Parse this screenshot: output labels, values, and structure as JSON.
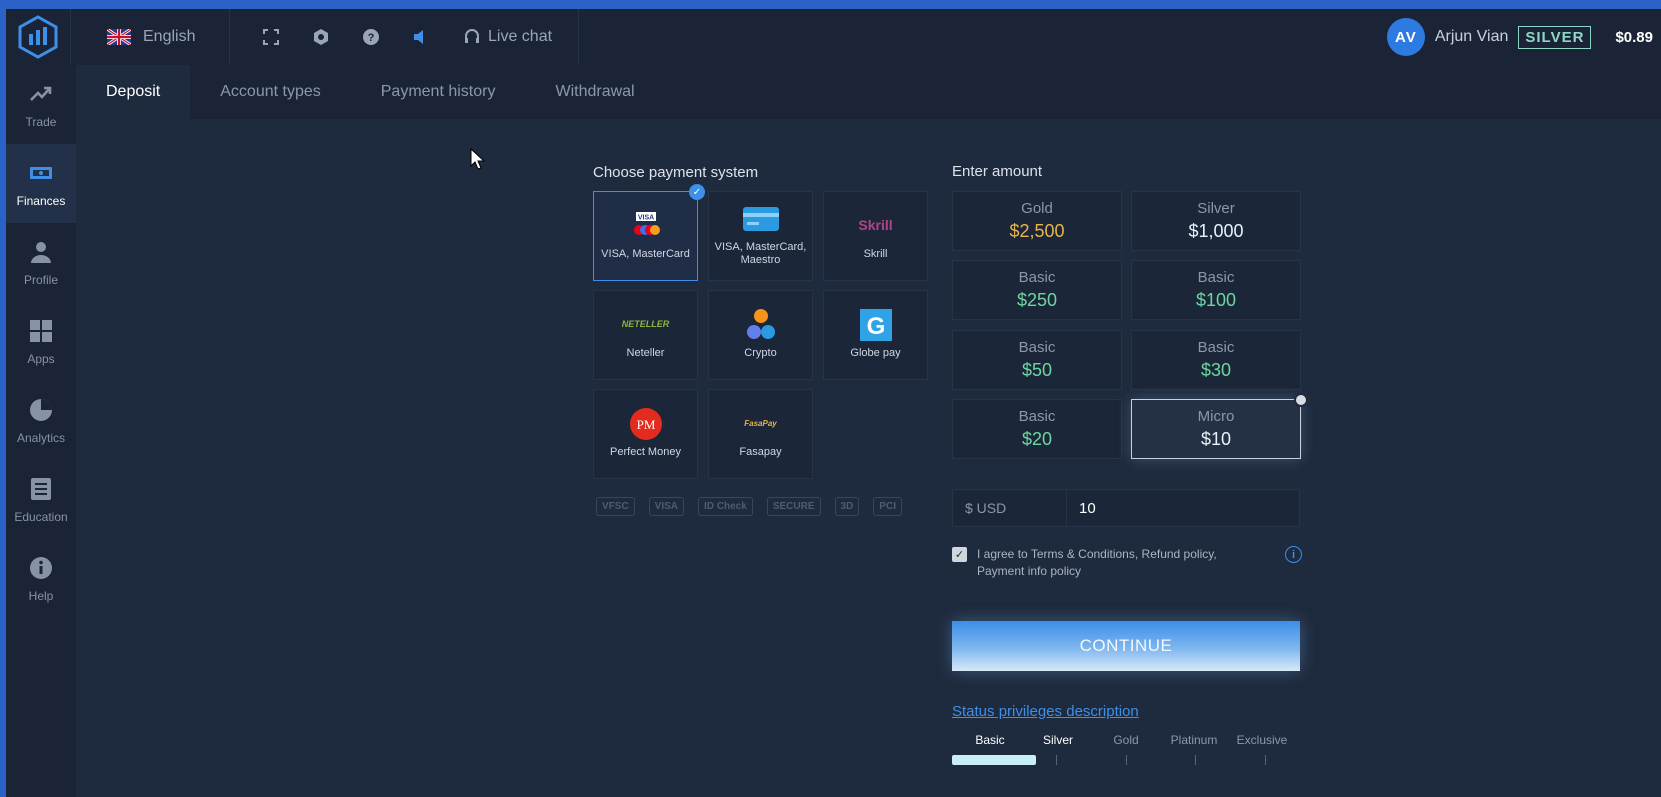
{
  "header": {
    "language": "English",
    "live_chat": "Live chat",
    "user_initials": "AV",
    "user_name": "Arjun Vian",
    "status": "SILVER",
    "balance": "$0.89"
  },
  "sidebar": {
    "items": [
      {
        "label": "Trade",
        "icon": "trend-icon"
      },
      {
        "label": "Finances",
        "icon": "wallet-icon",
        "active": true
      },
      {
        "label": "Profile",
        "icon": "user-icon"
      },
      {
        "label": "Apps",
        "icon": "grid-icon"
      },
      {
        "label": "Analytics",
        "icon": "pie-icon"
      },
      {
        "label": "Education",
        "icon": "book-icon"
      },
      {
        "label": "Help",
        "icon": "info-icon"
      }
    ]
  },
  "tabs": [
    "Deposit",
    "Account types",
    "Payment history",
    "Withdrawal"
  ],
  "payment": {
    "title": "Choose payment system",
    "methods": [
      {
        "label": "VISA, MasterCard",
        "selected": true
      },
      {
        "label": "VISA, MasterCard, Maestro"
      },
      {
        "label": "Skrill"
      },
      {
        "label": "Neteller"
      },
      {
        "label": "Crypto"
      },
      {
        "label": "Globe pay"
      },
      {
        "label": "Perfect Money"
      },
      {
        "label": "Fasapay"
      }
    ],
    "logo_text": {
      "visa": "VISA",
      "skrill": "Skrill",
      "neteller": "NETELLER",
      "globe": "G",
      "pm": "PM",
      "fasapay": "FasaPay"
    },
    "certs": [
      "VFSC",
      "VISA",
      "ID Check",
      "SECURE",
      "3D",
      "PCI"
    ]
  },
  "amount": {
    "title": "Enter amount",
    "options": [
      {
        "tier": "Gold",
        "value": "$2,500",
        "color": "#e8b54a"
      },
      {
        "tier": "Silver",
        "value": "$1,000",
        "color": "#e8f2f8"
      },
      {
        "tier": "Basic",
        "value": "$250",
        "color": "#6fd5a0"
      },
      {
        "tier": "Basic",
        "value": "$100",
        "color": "#6fd5a0"
      },
      {
        "tier": "Basic",
        "value": "$50",
        "color": "#6fd5a0"
      },
      {
        "tier": "Basic",
        "value": "$30",
        "color": "#6fd5a0"
      },
      {
        "tier": "Basic",
        "value": "$20",
        "color": "#6fd5a0"
      },
      {
        "tier": "Micro",
        "value": "$10",
        "color": "#e8f2f8",
        "selected": true
      }
    ],
    "currency_label": "$ USD",
    "input_value": "10",
    "agree_text": "I agree to Terms & Conditions, Refund policy, Payment info policy",
    "continue_label": "CONTINUE",
    "status_link": "Status privileges description",
    "levels": [
      "Basic",
      "Silver",
      "Gold",
      "Platinum",
      "Exclusive"
    ],
    "level_progress": 0.24
  }
}
